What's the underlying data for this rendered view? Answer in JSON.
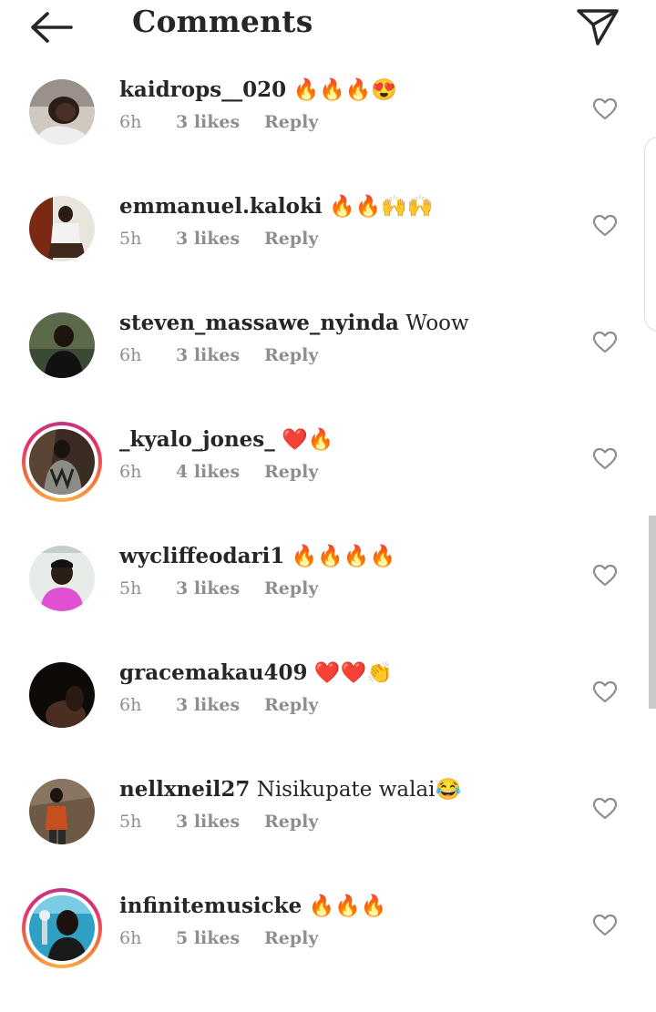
{
  "header": {
    "title": "Comments",
    "back_icon": "back-arrow-icon",
    "share_icon": "send-icon"
  },
  "comments": [
    {
      "username": "kaidrops__020",
      "text": "🔥🔥🔥😍",
      "time": "6h",
      "likes": "3 likes",
      "reply": "Reply"
    },
    {
      "username": "emmanuel.kaloki",
      "text": "🔥🔥🙌🙌",
      "time": "5h",
      "likes": "3 likes",
      "reply": "Reply"
    },
    {
      "username": "steven_massawe_nyinda",
      "text": "Woow",
      "time": "6h",
      "likes": "3 likes",
      "reply": "Reply"
    },
    {
      "username": "_kyalo_jones_",
      "text": "❤️🔥",
      "time": "6h",
      "likes": "4 likes",
      "reply": "Reply"
    },
    {
      "username": "wycliffeodari1",
      "text": "🔥🔥🔥🔥",
      "time": "5h",
      "likes": "3 likes",
      "reply": "Reply"
    },
    {
      "username": "gracemakau409",
      "text": "❤️❤️👏",
      "time": "6h",
      "likes": "3 likes",
      "reply": "Reply"
    },
    {
      "username": "nellxneil27",
      "text": "Nisikupate walai😂",
      "time": "5h",
      "likes": "3 likes",
      "reply": "Reply"
    },
    {
      "username": "infinitemusicke",
      "text": "🔥🔥🔥",
      "time": "6h",
      "likes": "5 likes",
      "reply": "Reply"
    }
  ],
  "colors": {
    "text": "#262626",
    "secondary": "#8e8e8e",
    "story_ring": "#e1306c"
  }
}
